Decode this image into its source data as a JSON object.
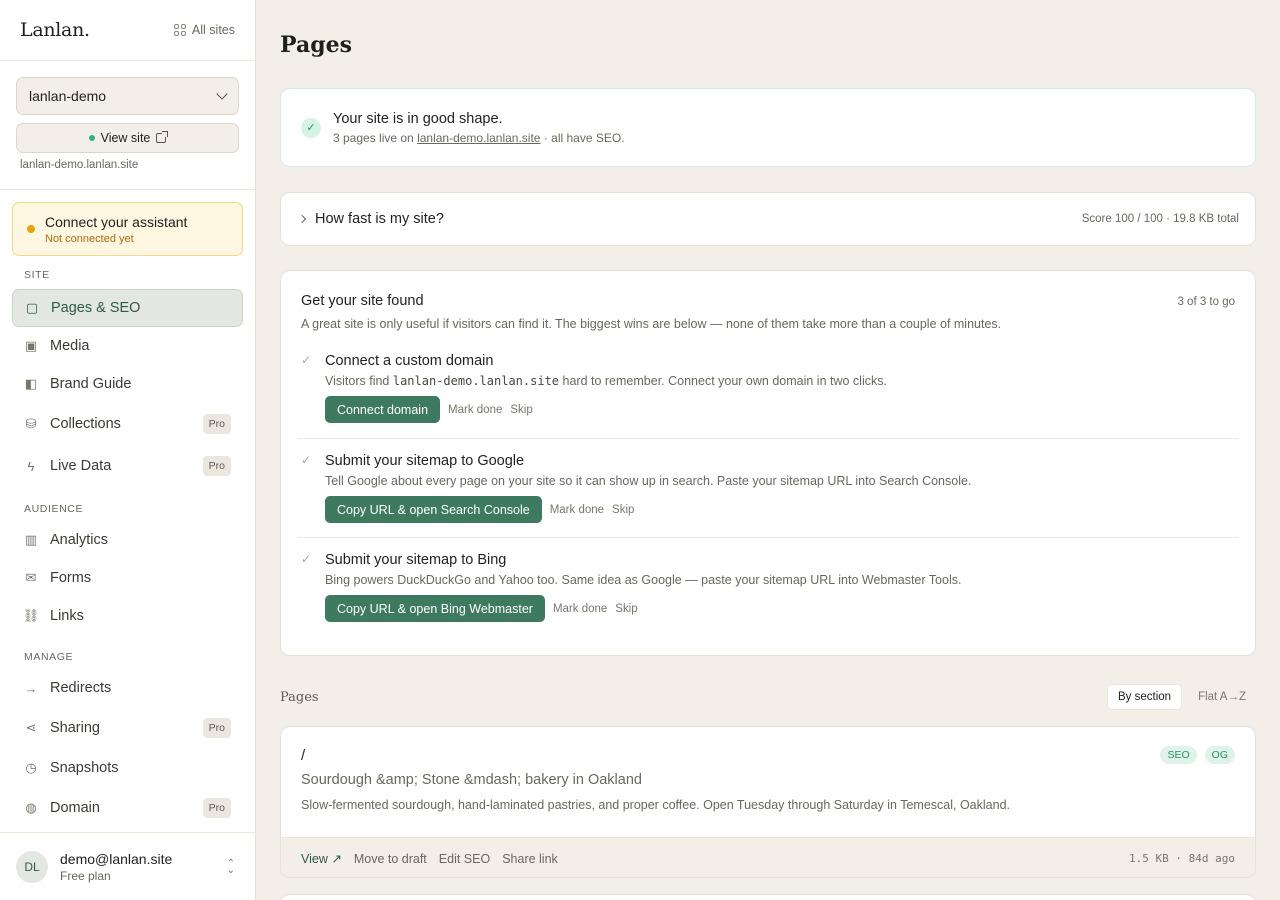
{
  "sidebar": {
    "logo": "Lanlan.",
    "all_sites": "All sites",
    "site_select": "lanlan-demo",
    "view_site": "View site",
    "site_url": "lanlan-demo.lanlan.site",
    "assistant": {
      "title": "Connect your assistant",
      "status": "Not connected yet"
    },
    "sections": {
      "site": "SITE",
      "audience": "AUDIENCE",
      "manage": "MANAGE"
    },
    "items": {
      "pages_seo": "Pages & SEO",
      "media": "Media",
      "brand_guide": "Brand Guide",
      "collections": "Collections",
      "live_data": "Live Data",
      "analytics": "Analytics",
      "forms": "Forms",
      "links": "Links",
      "redirects": "Redirects",
      "sharing": "Sharing",
      "snapshots": "Snapshots",
      "domain": "Domain"
    },
    "pro_badge": "Pro",
    "user": {
      "initials": "DL",
      "email": "demo@lanlan.site",
      "plan": "Free plan"
    }
  },
  "main": {
    "title": "Pages",
    "status": {
      "title": "Your site is in good shape.",
      "sub_prefix": "3 pages live on ",
      "sub_link": "lanlan-demo.lanlan.site",
      "sub_suffix": " · all have SEO."
    },
    "speed": {
      "label": "How fast is my site?",
      "summary": "Score 100 / 100 · 19.8 KB total"
    },
    "found": {
      "title": "Get your site found",
      "count": "3 of 3 to go",
      "desc": "A great site is only useful if visitors can find it. The biggest wins are below — none of them take more than a couple of minutes.",
      "mark_done": "Mark done",
      "skip": "Skip",
      "tasks": [
        {
          "title": "Connect a custom domain",
          "desc_prefix": "Visitors find ",
          "desc_code": "lanlan-demo.lanlan.site",
          "desc_suffix": " hard to remember. Connect your own domain in two clicks.",
          "button": "Connect domain"
        },
        {
          "title": "Submit your sitemap to Google",
          "desc": "Tell Google about every page on your site so it can show up in search. Paste your sitemap URL into Search Console.",
          "button": "Copy URL & open Search Console"
        },
        {
          "title": "Submit your sitemap to Bing",
          "desc": "Bing powers DuckDuckGo and Yahoo too. Same idea as Google — paste your sitemap URL into Webmaster Tools.",
          "button": "Copy URL & open Bing Webmaster"
        }
      ]
    },
    "pages": {
      "label": "Pages",
      "view_by_section": "By section",
      "view_flat": "Flat A→Z",
      "items": [
        {
          "path": "/",
          "title": "Sourdough &amp; Stone &mdash; bakery in Oakland",
          "desc": "Slow-fermented sourdough, hand-laminated pastries, and proper coffee. Open Tuesday through Saturday in Temescal, Oakland.",
          "badges": [
            "SEO",
            "OG"
          ],
          "actions": {
            "view": "View ↗",
            "draft": "Move to draft",
            "edit_seo": "Edit SEO",
            "share": "Share link"
          },
          "meta": "1.5 KB · 84d ago"
        }
      ]
    }
  }
}
